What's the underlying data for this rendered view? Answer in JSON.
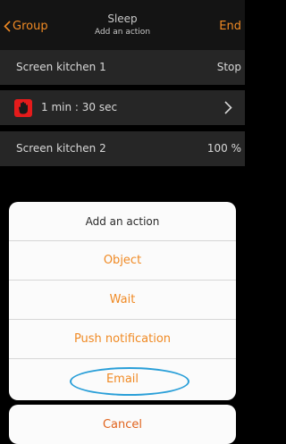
{
  "navbar": {
    "back_label": "Group",
    "title": "Sleep",
    "subtitle": "Add an action",
    "end_label": "End"
  },
  "rows": [
    {
      "label": "Screen kitchen 1",
      "value": "Stop"
    },
    {
      "label": "1 min : 30 sec",
      "icon": "hand-stop-icon",
      "accessory": "chevron-right-icon"
    },
    {
      "label": "Screen kitchen 2",
      "value": "100 %"
    }
  ],
  "action_sheet": {
    "title": "Add an action",
    "options": [
      "Object",
      "Wait",
      "Push notification",
      "Email"
    ],
    "cancel_label": "Cancel"
  },
  "colors": {
    "accent_orange": "#f08a24",
    "icon_red": "#e51b1b",
    "highlight_blue": "#2a9fd8"
  }
}
